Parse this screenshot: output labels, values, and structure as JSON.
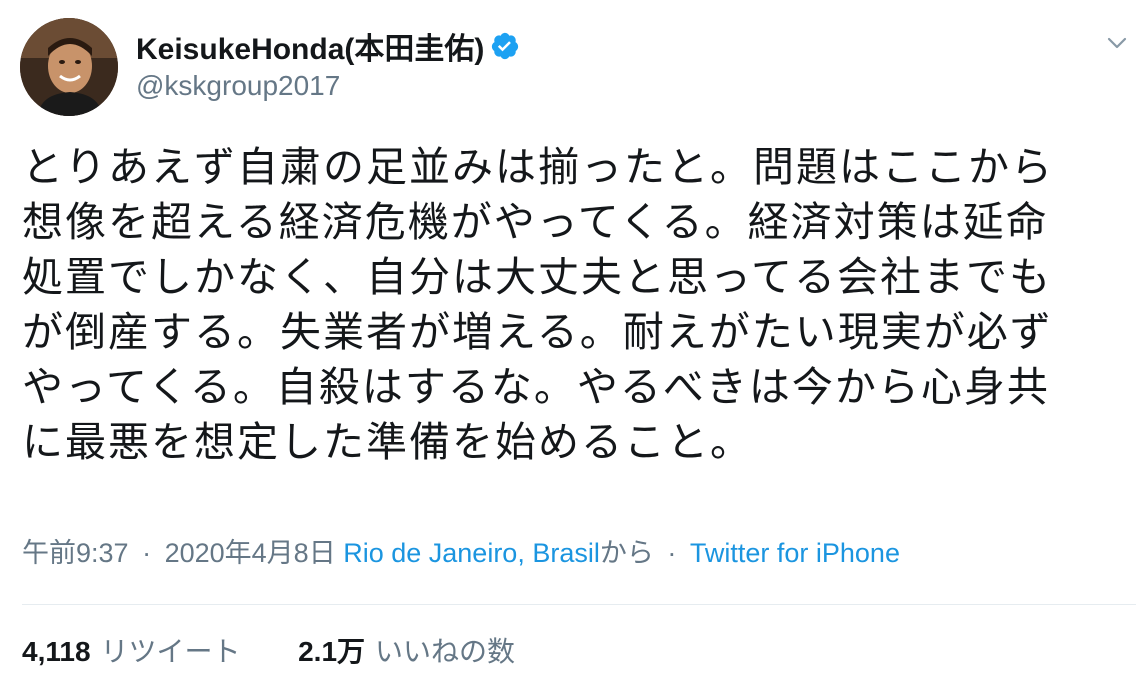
{
  "author": {
    "display_name": "KeisukeHonda(本田圭佑)",
    "handle": "@kskgroup2017",
    "verified": true
  },
  "tweet": {
    "lines": [
      "とりあえず自粛の足並みは揃ったと。問題はここから",
      "想像を超える経済危機がやってくる。経済対策は延命",
      "処置でしかなく、自分は大丈夫と思ってる会社までも",
      "が倒産する。失業者が増える。耐えがたい現実が必ず",
      "やってくる。自殺はするな。やるべきは今から心身共",
      "に最悪を想定した準備を始めること。"
    ]
  },
  "meta": {
    "time": "午前9:37",
    "separator": "·",
    "date": "2020年4月8日",
    "location": "Rio de Janeiro, Brasil",
    "location_suffix": "から",
    "source": "Twitter for iPhone"
  },
  "stats": {
    "retweet_count": "4,118",
    "retweet_label": "リツイート",
    "like_count": "2.1万",
    "like_label": "いいねの数"
  },
  "colors": {
    "text": "#14171a",
    "secondary": "#657786",
    "link": "#1b95e0",
    "verified": "#1da1f2",
    "divider": "#e6ecf0"
  },
  "icons": {
    "verified": "verified-badge-icon",
    "more": "chevron-down-icon"
  }
}
